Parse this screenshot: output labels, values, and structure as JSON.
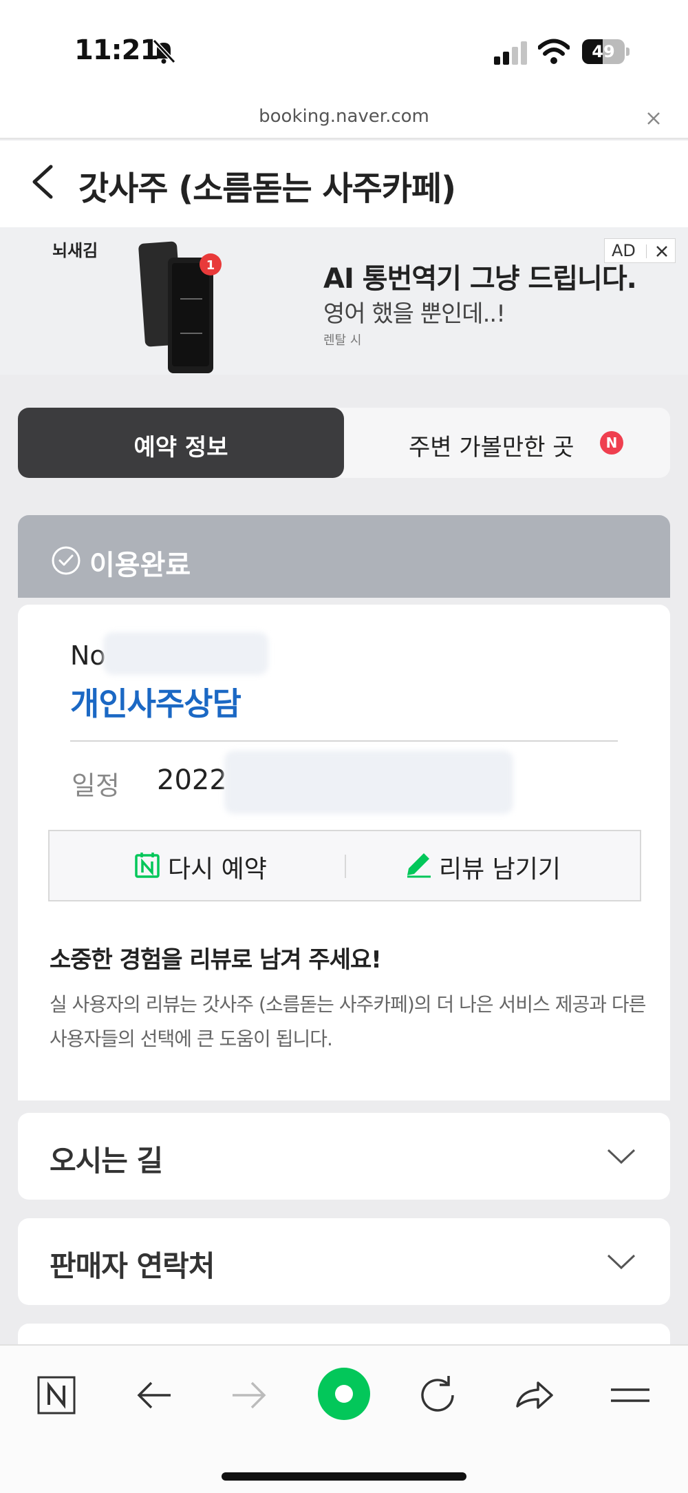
{
  "status_bar": {
    "time": "11:21",
    "battery": "49",
    "battery_level": 0.49
  },
  "browser": {
    "url": "booking.naver.com"
  },
  "header": {
    "title": "갓사주 (소름돋는 사주카페)"
  },
  "ad": {
    "brand": "뇌새김",
    "phone_badge": "1",
    "headline": "AI 통번역기 그냥 드립니다.",
    "subtext": "영어 했을 뿐인데..!",
    "note": "렌탈 시",
    "badge_label": "AD"
  },
  "tabs": {
    "active_label": "예약 정보",
    "other_label": "주변 가볼만한 곳",
    "new_badge": "N"
  },
  "booking": {
    "status": "이용완료",
    "number_prefix": "No",
    "service_name": "개인사주상담",
    "schedule_label": "일정",
    "schedule_value": "2022",
    "rebook_label": "다시 예약",
    "review_label": "리뷰 남기기",
    "review_heading": "소중한 경험을 리뷰로 남겨 주세요!",
    "review_description": "실 사용자의 리뷰는 갓사주 (소름돋는 사주카페)의 더 나은 서비스 제공과 다른 사용자들의 선택에 큰 도움이 됩니다."
  },
  "sections": {
    "directions": "오시는 길",
    "seller_contact": "판매자 연락처"
  },
  "colors": {
    "accent_blue": "#1b68c4",
    "active_tab": "#3c3c3e",
    "status_gray": "#aeb2b9",
    "naver_green": "#03c75a",
    "badge_red": "#ef3f4f"
  },
  "toolbar_icons": [
    "naver-home-icon",
    "back-arrow-icon",
    "forward-arrow-icon",
    "green-dot-icon",
    "reload-icon",
    "share-icon",
    "menu-icon"
  ]
}
